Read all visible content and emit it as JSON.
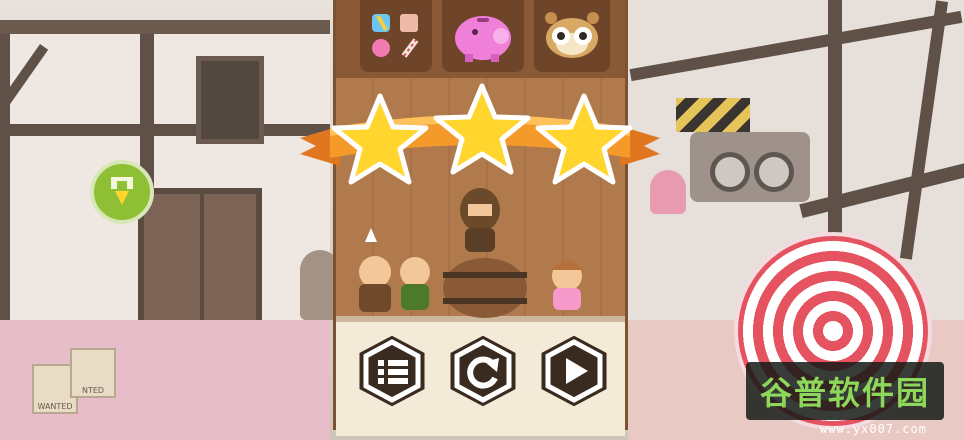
{
  "screen": "level-complete",
  "stars_earned": 3,
  "stars_total": 3,
  "collectibles": {
    "items": [
      "sweets-bundle",
      "piggy-bank",
      "hamster-face"
    ]
  },
  "buttons": {
    "menu": "menu",
    "restart": "restart",
    "next": "next"
  },
  "scene_signs": {
    "wanted_1": "WANTED",
    "wanted_2": "NTED"
  },
  "watermark": {
    "title": "谷普软件园",
    "url": "www.yx007.com"
  },
  "colors": {
    "panel_wood": "#b07a4c",
    "ribbon_orange": "#f39a2b",
    "star_yellow": "#ffd52e",
    "button_dark": "#3a2b20",
    "button_light": "#f4ead8",
    "watermark_green": "#8dd75a"
  }
}
